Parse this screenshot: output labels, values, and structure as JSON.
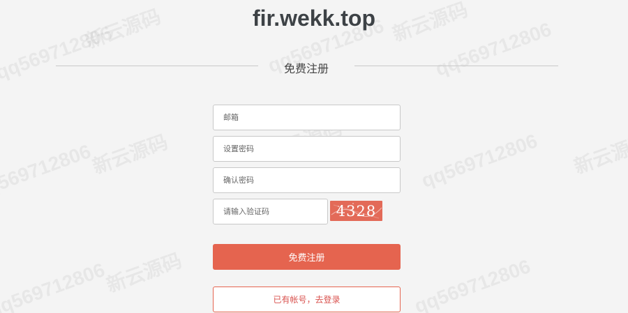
{
  "header": {
    "site_title": "fir.wekk.top"
  },
  "form": {
    "section_title": "免费注册",
    "email_placeholder": "邮箱",
    "password_placeholder": "设置密码",
    "confirm_password_placeholder": "确认密码",
    "captcha_placeholder": "请输入验证码",
    "captcha_code": "4328",
    "submit_label": "免费注册",
    "login_link_label": "已有帐号，去登录"
  },
  "watermark": {
    "text_a": "新云源码",
    "text_b": "qq569712806"
  },
  "colors": {
    "accent": "#e5644f",
    "background": "#f4f4f4",
    "title": "#3d4246"
  }
}
